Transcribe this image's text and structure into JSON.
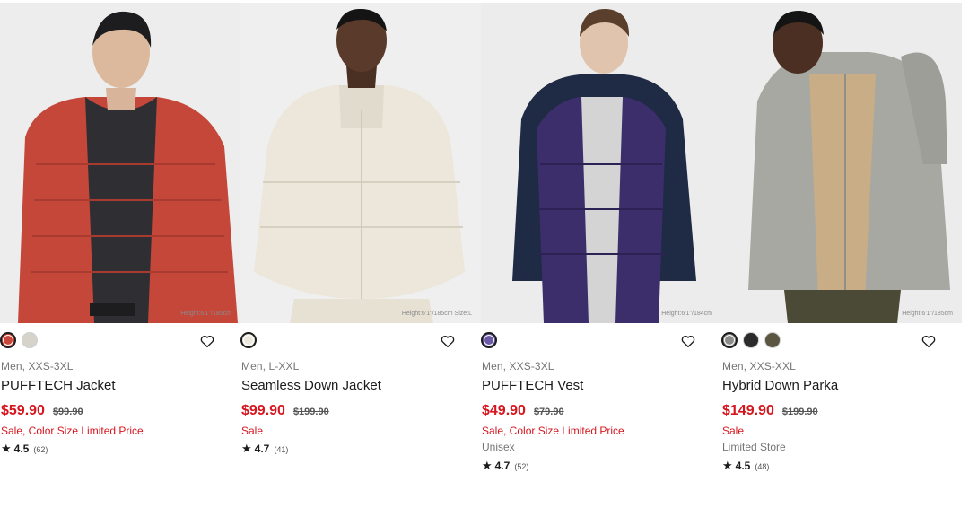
{
  "products": [
    {
      "image_caption": "Height:6'1\"/185cm",
      "colors": [
        {
          "hex": "#c9473a",
          "selected": true
        },
        {
          "hex": "#d6d3cb",
          "selected": false
        }
      ],
      "meta": "Men, XXS-3XL",
      "name": "PUFFTECH Jacket",
      "price": "$59.90",
      "original_price": "$99.90",
      "flag": "Sale, Color Size Limited Price",
      "extra": "",
      "rating": "4.5",
      "review_count": "(62)"
    },
    {
      "image_caption": "Height:6'1\"/185cm Size:L",
      "colors": [
        {
          "hex": "#ece8dd",
          "selected": true
        }
      ],
      "meta": "Men, L-XXL",
      "name": "Seamless Down Jacket",
      "price": "$99.90",
      "original_price": "$199.90",
      "flag": "Sale",
      "extra": "",
      "rating": "4.7",
      "review_count": "(41)"
    },
    {
      "image_caption": "Height:6'1\"/184cm",
      "colors": [
        {
          "hex": "#6b5aa6",
          "selected": true
        }
      ],
      "meta": "Men, XXS-3XL",
      "name": "PUFFTECH Vest",
      "price": "$49.90",
      "original_price": "$79.90",
      "flag": "Sale, Color Size Limited Price",
      "extra": "Unisex",
      "rating": "4.7",
      "review_count": "(52)"
    },
    {
      "image_caption": "Height:6'1\"/185cm",
      "colors": [
        {
          "hex": "#8c8c8a",
          "selected": true
        },
        {
          "hex": "#2b2b2b",
          "selected": false
        },
        {
          "hex": "#5b5642",
          "selected": false
        }
      ],
      "meta": "Men, XXS-XXL",
      "name": "Hybrid Down Parka",
      "price": "$149.90",
      "original_price": "$199.90",
      "flag": "Sale",
      "extra": "Limited Store",
      "rating": "4.5",
      "review_count": "(48)"
    }
  ],
  "icons": {
    "wishlist": "heart-outline-icon",
    "rating": "star-icon"
  }
}
